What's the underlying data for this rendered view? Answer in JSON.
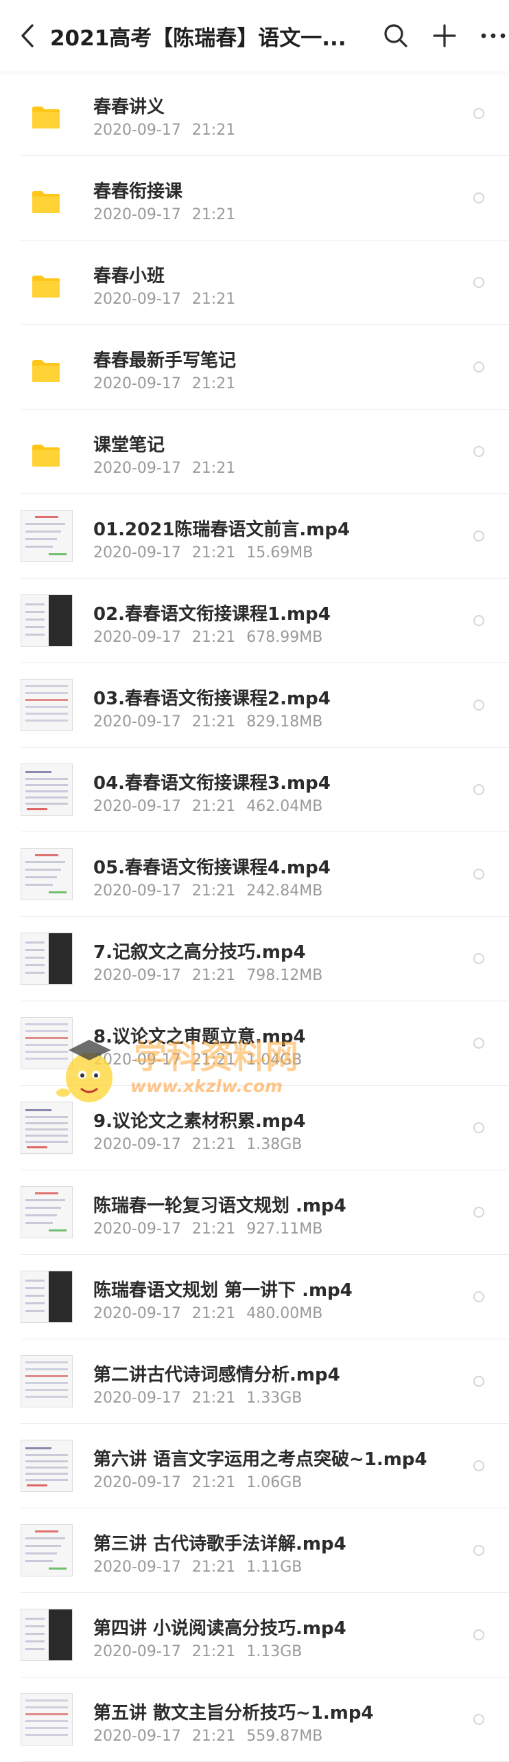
{
  "header": {
    "title": "2021高考【陈瑞春】语文一...",
    "back_icon": "chevron-left-icon",
    "search_icon": "search-icon",
    "add_icon": "plus-icon",
    "more_icon": "more-horizontal-icon"
  },
  "colors": {
    "folder": "#FFC61A",
    "title_text": "#1F1F1F",
    "meta_text": "#9A9A9A",
    "divider": "#ECECEC"
  },
  "items": [
    {
      "kind": "folder",
      "name": "春春讲义",
      "date": "2020-09-17",
      "time": "21:21",
      "size": ""
    },
    {
      "kind": "folder",
      "name": "春春衔接课",
      "date": "2020-09-17",
      "time": "21:21",
      "size": ""
    },
    {
      "kind": "folder",
      "name": "春春小班",
      "date": "2020-09-17",
      "time": "21:21",
      "size": ""
    },
    {
      "kind": "folder",
      "name": "春春最新手写笔记",
      "date": "2020-09-17",
      "time": "21:21",
      "size": ""
    },
    {
      "kind": "folder",
      "name": "课堂笔记",
      "date": "2020-09-17",
      "time": "21:21",
      "size": ""
    },
    {
      "kind": "video",
      "name": "01.2021陈瑞春语文前言.mp4",
      "date": "2020-09-17",
      "time": "21:21",
      "size": "15.69MB"
    },
    {
      "kind": "video",
      "name": "02.春春语文衔接课程1.mp4",
      "date": "2020-09-17",
      "time": "21:21",
      "size": "678.99MB"
    },
    {
      "kind": "video",
      "name": "03.春春语文衔接课程2.mp4",
      "date": "2020-09-17",
      "time": "21:21",
      "size": "829.18MB"
    },
    {
      "kind": "video",
      "name": "04.春春语文衔接课程3.mp4",
      "date": "2020-09-17",
      "time": "21:21",
      "size": "462.04MB"
    },
    {
      "kind": "video",
      "name": "05.春春语文衔接课程4.mp4",
      "date": "2020-09-17",
      "time": "21:21",
      "size": "242.84MB"
    },
    {
      "kind": "video",
      "name": "7.记叙文之高分技巧.mp4",
      "date": "2020-09-17",
      "time": "21:21",
      "size": "798.12MB"
    },
    {
      "kind": "video",
      "name": "8.议论文之审题立意.mp4",
      "date": "2020-09-17",
      "time": "21:21",
      "size": "1.04GB"
    },
    {
      "kind": "video",
      "name": "9.议论文之素材积累.mp4",
      "date": "2020-09-17",
      "time": "21:21",
      "size": "1.38GB"
    },
    {
      "kind": "video",
      "name": "陈瑞春一轮复习语文规划  .mp4",
      "date": "2020-09-17",
      "time": "21:21",
      "size": "927.11MB"
    },
    {
      "kind": "video",
      "name": "陈瑞春语文规划 第一讲下  .mp4",
      "date": "2020-09-17",
      "time": "21:21",
      "size": "480.00MB"
    },
    {
      "kind": "video",
      "name": "第二讲古代诗词感情分析.mp4",
      "date": "2020-09-17",
      "time": "21:21",
      "size": "1.33GB"
    },
    {
      "kind": "video",
      "name": "第六讲 语言文字运用之考点突破~1.mp4",
      "date": "2020-09-17",
      "time": "21:21",
      "size": "1.06GB"
    },
    {
      "kind": "video",
      "name": "第三讲 古代诗歌手法详解.mp4",
      "date": "2020-09-17",
      "time": "21:21",
      "size": "1.11GB"
    },
    {
      "kind": "video",
      "name": "第四讲 小说阅读高分技巧.mp4",
      "date": "2020-09-17",
      "time": "21:21",
      "size": "1.13GB"
    },
    {
      "kind": "video",
      "name": "第五讲 散文主旨分析技巧~1.mp4",
      "date": "2020-09-17",
      "time": "21:21",
      "size": "559.87MB"
    }
  ],
  "watermark": {
    "text": "学科资料网",
    "url": "www.xkzlw.com",
    "icon": "mascot-logo-icon"
  }
}
